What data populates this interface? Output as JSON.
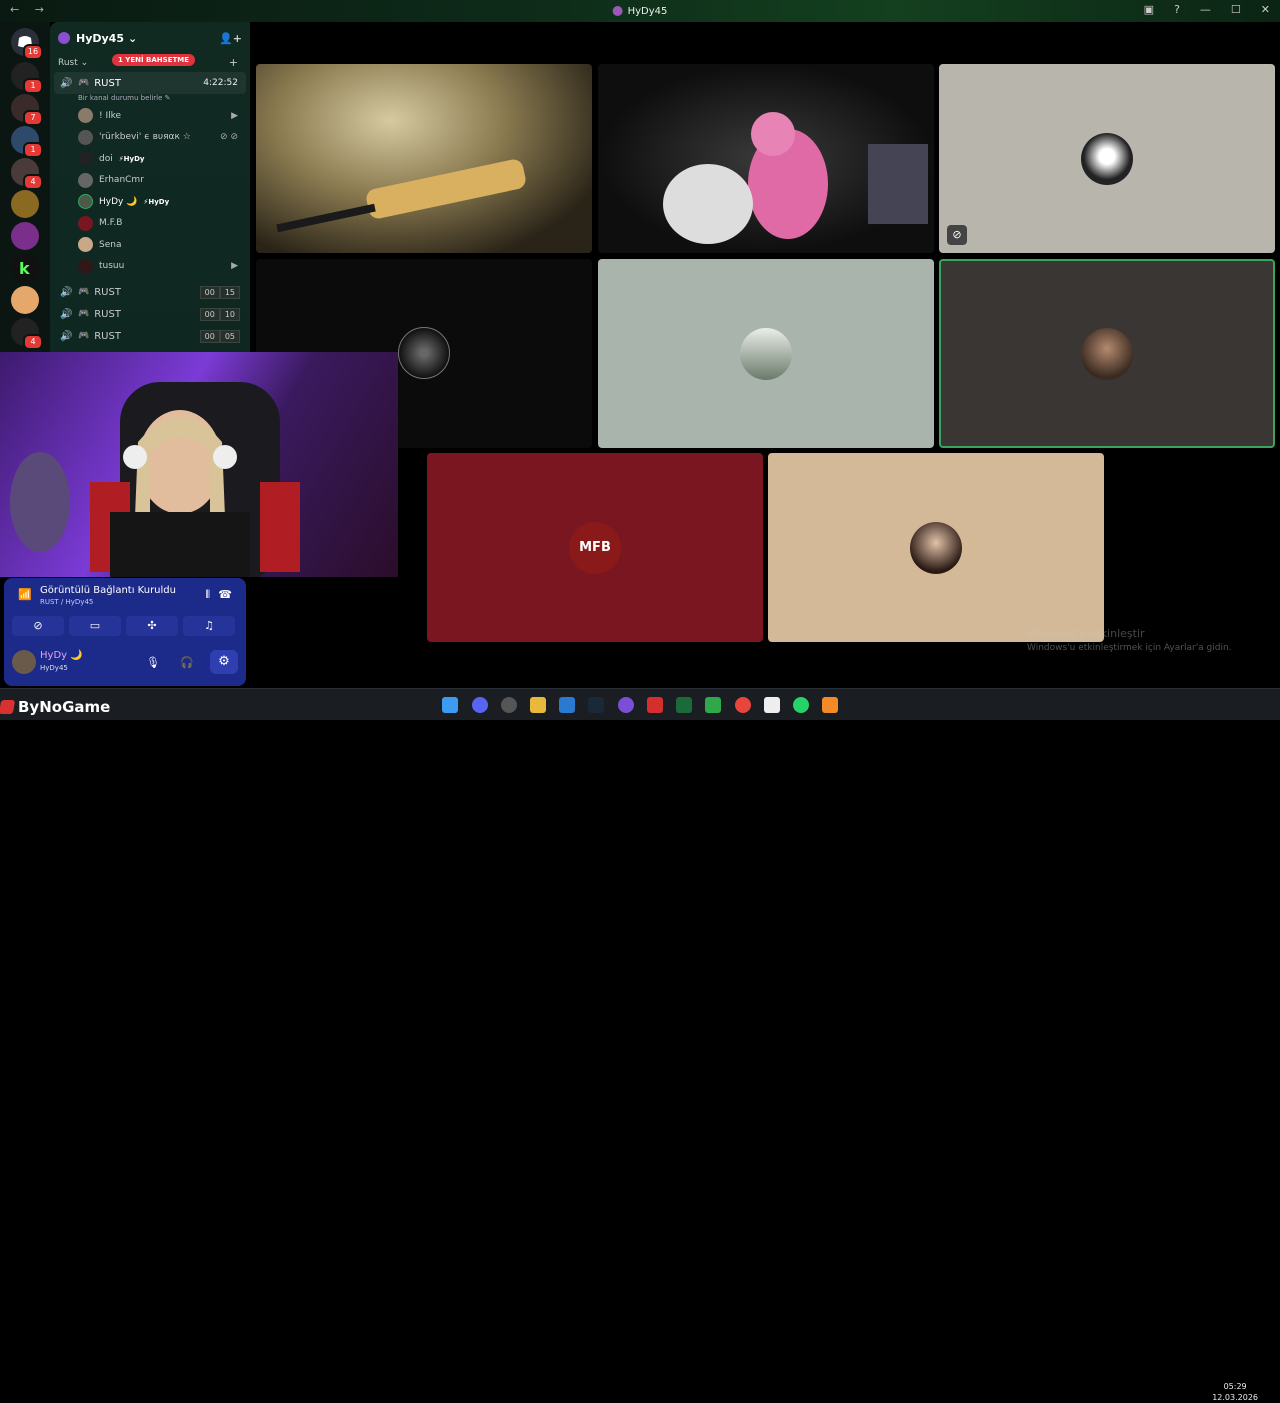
{
  "titlebar": {
    "back": "←",
    "forward": "→",
    "title": "HyDy45"
  },
  "guild_badges": [
    "16",
    "1",
    "7",
    "1",
    "4",
    "4"
  ],
  "server": {
    "name": "HyDy45",
    "category": "Rust",
    "mention_pill": "1 YENİ BAHSETME"
  },
  "active_channel": {
    "name": "RUST",
    "timer": "4:22:52",
    "status_placeholder": "Bir kanal durumu belirle"
  },
  "members": [
    {
      "name": "! Ilke",
      "tag": ""
    },
    {
      "name": "'rürkbevi' ϵ вυяαк ☆",
      "tag": ""
    },
    {
      "name": "doi",
      "tag": "HyDy"
    },
    {
      "name": "ErhanCmr",
      "tag": ""
    },
    {
      "name": "HyDy 🌙",
      "tag": "HyDy"
    },
    {
      "name": "M.F.B",
      "tag": ""
    },
    {
      "name": "Sena",
      "tag": ""
    },
    {
      "name": "tusuu",
      "tag": ""
    }
  ],
  "other_channels": [
    {
      "name": "RUST",
      "a": "00",
      "b": "15"
    },
    {
      "name": "RUST",
      "a": "00",
      "b": "10"
    },
    {
      "name": "RUST",
      "a": "00",
      "b": "05"
    }
  ],
  "voice_panel": {
    "status": "Görüntülü Bağlantı Kuruldu",
    "location": "RUST / HyDy45",
    "user_display": "HyDy 🌙",
    "user_sub": "HyDy45"
  },
  "tiles": {
    "mfb_label": "MFB"
  },
  "watermark": {
    "line1": "Windows'u etkinleştir",
    "line2": "Windows'u etkinleştirmek için Ayarlar'a gidin."
  },
  "brand": "ByNoGame",
  "clock": {
    "time": "05:29",
    "date": "12.03.2026"
  },
  "colors": {
    "accent": "#5865f2",
    "speaking": "#3ba55d",
    "mfb_bg": "#7a161f",
    "sena_bg": "#d3b998"
  }
}
